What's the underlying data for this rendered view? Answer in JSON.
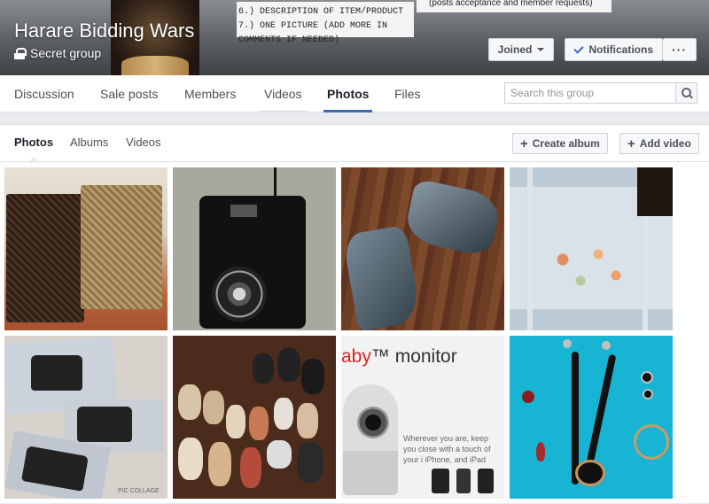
{
  "group": {
    "name": "Harare Bidding Wars",
    "privacy": "Secret group",
    "cover_notes": [
      "6.) DESCRIPTION OF ITEM/PRODUCT",
      "7.) ONE PICTURE (ADD MORE IN COMMENTS IF NEEDED)"
    ],
    "cover_notes_right": "(posts acceptance and member requests)"
  },
  "cover_buttons": {
    "joined": "Joined",
    "notifications": "Notifications",
    "more": "···"
  },
  "nav": {
    "tabs": [
      "Discussion",
      "Sale posts",
      "Members",
      "Videos",
      "Photos",
      "Files"
    ],
    "active": "Photos",
    "search_placeholder": "Search this group"
  },
  "photos_section": {
    "subtabs": [
      "Photos",
      "Albums",
      "Videos"
    ],
    "active": "Photos",
    "create_album": "Create album",
    "add_video": "Add video"
  },
  "photos": [
    {
      "subject": "wicker laundry baskets"
    },
    {
      "subject": "digital camera"
    },
    {
      "subject": "grey high-heel ankle boots"
    },
    {
      "subject": "baby blanket"
    },
    {
      "subject": "handbags collage",
      "watermark": "PIC COLLAGE"
    },
    {
      "subject": "assorted shoes"
    },
    {
      "subject": "baby monitor box",
      "heading_a": "aby",
      "heading_b": "monitor",
      "copy": "Wherever you are, keep you close with a touch of your i iPhone, and iPad"
    },
    {
      "subject": "beaded jewelry set"
    }
  ],
  "colors": {
    "accent": "#4267b2",
    "nav_bg": "#ffffff",
    "page_bg": "#e9ebee"
  }
}
